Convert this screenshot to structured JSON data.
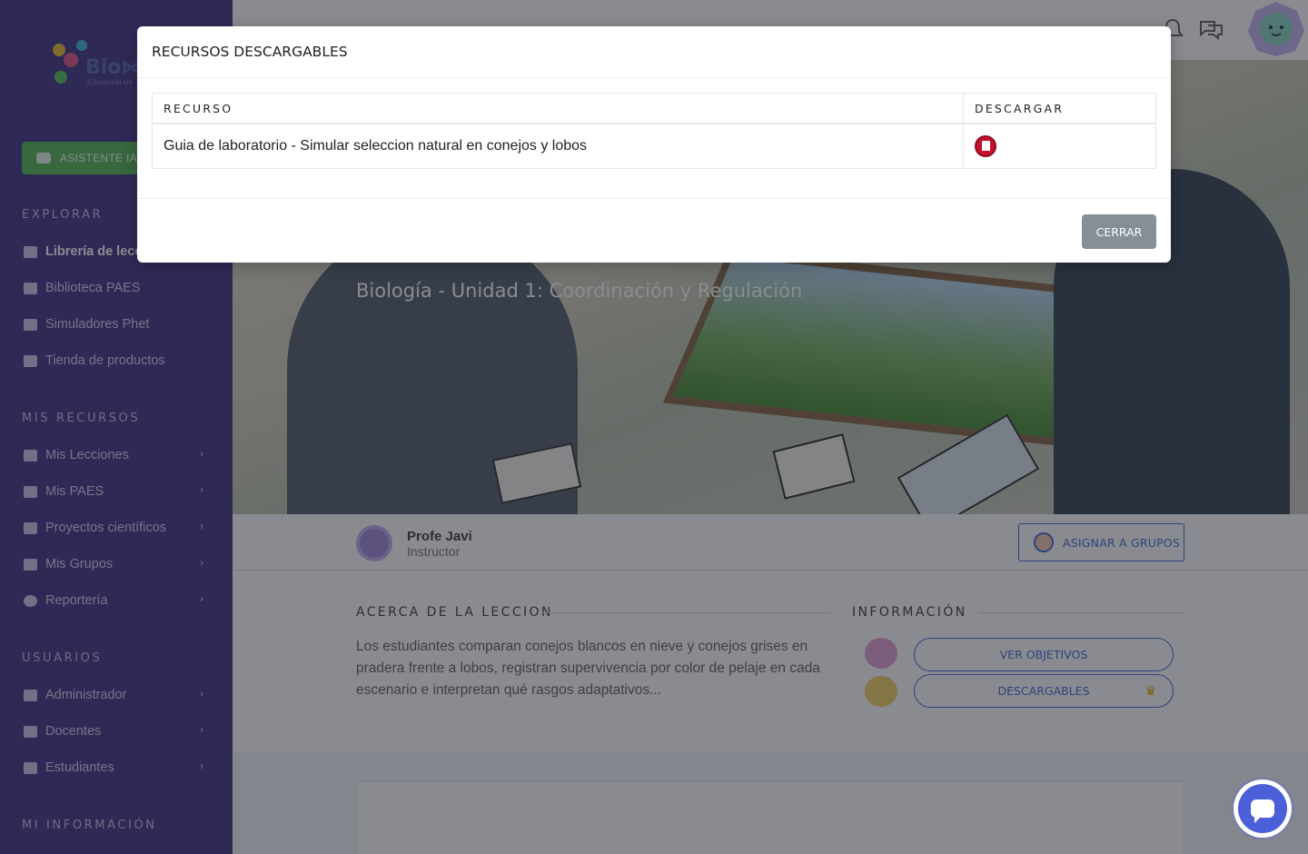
{
  "app": {
    "logo_text": "Bio⋈C",
    "logo_sub": "Educación cie"
  },
  "sidebar": {
    "ai_button": "ASISTENTE IA",
    "sections": {
      "explorar": "EXPLORAR",
      "mis_recursos": "MIS RECURSOS",
      "usuarios": "USUARIOS",
      "mi_informacion": "MI INFORMACIÓN"
    },
    "explorar_items": [
      {
        "label": "Librería de lecc"
      },
      {
        "label": "Biblioteca PAES"
      },
      {
        "label": "Simuladores Phet"
      },
      {
        "label": "Tienda de productos"
      }
    ],
    "recursos_items": [
      {
        "label": "Mis Lecciones"
      },
      {
        "label": "Mis PAES"
      },
      {
        "label": "Proyectos científicos"
      },
      {
        "label": "Mis Grupos"
      },
      {
        "label": "Reportería"
      }
    ],
    "usuarios_items": [
      {
        "label": "Administrador"
      },
      {
        "label": "Docentes"
      },
      {
        "label": "Estudiantes"
      }
    ],
    "chevron": "›"
  },
  "hero": {
    "title": "Biología - Unidad 1: Coordinación y Regulación"
  },
  "instructor": {
    "name": "Profe Javi",
    "role": "Instructor",
    "assign_button": "ASIGNAR A GRUPOS"
  },
  "about": {
    "title": "ACERCA DE LA LECCION",
    "text": "Los estudiantes comparan conejos blancos en nieve y conejos grises en pradera frente a lobos, registran supervivencia por color de pelaje en cada escenario e interpretan qué rasgos adaptativos..."
  },
  "info": {
    "title": "INFORMACIÓN",
    "objectives_button": "VER OBJETIVOS",
    "downloads_button": "DESCARGABLES",
    "crown": "♛"
  },
  "modal": {
    "title": "RECURSOS DESCARGABLES",
    "columns": [
      "RECURSO",
      "DESCARGAR"
    ],
    "rows": [
      {
        "resource": "Guia de laboratorio - Simular seleccion natural en conejos y lobos",
        "icon": "pdf-icon"
      }
    ],
    "close_button": "CERRAR"
  },
  "colors": {
    "sidebar": "#4a3a8a",
    "accent": "#4a6fd4",
    "ai_green": "#5db85a",
    "pdf_red": "#c8102e",
    "close_gray": "#868e96"
  }
}
